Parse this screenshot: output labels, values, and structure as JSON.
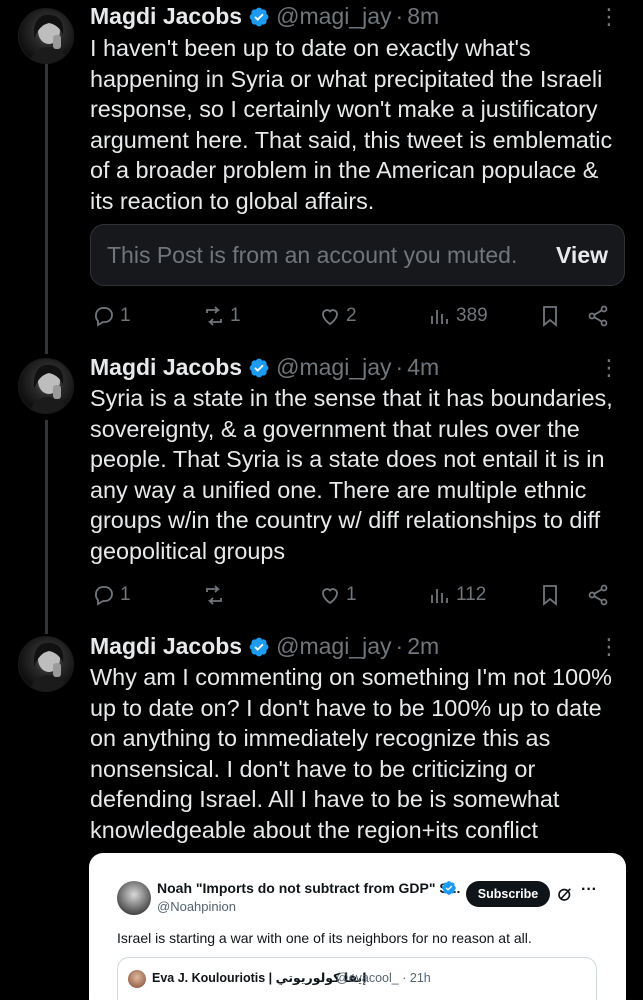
{
  "colors": {
    "background": "#000000",
    "text": "#e7e9ea",
    "muted": "#71767b",
    "verified": "#1d9bf0",
    "line": "#333639"
  },
  "tweets": [
    {
      "name": "Magdi Jacobs",
      "handle": "@magi_jay",
      "dot": "·",
      "time": "8m",
      "more": "⋮",
      "lines": [
        "I haven't been up to date on exactly what's",
        "happening in Syria or what precipitated the Israeli",
        "response, so I certainly won't make a justificatory",
        "argument here. That said, this tweet is emblematic",
        "of a broader problem in the American populace &",
        "its reaction to global affairs."
      ],
      "muted_notice": "This Post is from an account you muted.",
      "muted_view": "View",
      "replies": "1",
      "reposts": "1",
      "likes": "2",
      "views": "389"
    },
    {
      "name": "Magdi Jacobs",
      "handle": "@magi_jay",
      "dot": "·",
      "time": "4m",
      "more": "⋮",
      "lines": [
        "Syria is a state in the sense that it has boundaries,",
        "sovereignty, & a government that rules over the",
        "people. That Syria is a state does not entail it is in",
        "any way a unified one. There are multiple ethnic",
        "groups w/in the country w/ diff relationships to diff",
        "geopolitical groups"
      ],
      "replies": "1",
      "reposts": "",
      "likes": "1",
      "views": "112"
    },
    {
      "name": "Magdi Jacobs",
      "handle": "@magi_jay",
      "dot": "·",
      "time": "2m",
      "more": "⋮",
      "lines": [
        "Why am I commenting on something I'm not 100%",
        "up to date on? I don't have to be 100% up to date",
        "on anything to immediately recognize this as",
        "nonsensical. I don't have to be criticizing or",
        "defending Israel. All I have to be is somewhat",
        "knowledgeable about the region+its conflict"
      ]
    }
  ],
  "quote": {
    "name": "Noah \"Imports do not subtract from GDP\" S...",
    "handle": "@Noahpinion",
    "subscribe": "Subscribe",
    "more": "···",
    "text": "Israel is starting a war with one of its neighbors for no reason at all.",
    "inner": {
      "name": "Eva J. Koulouriotis | إيفا كولوريوتي",
      "handle": "@evacool_",
      "dot": "·",
      "time": "21h"
    }
  },
  "icons": [
    "reply-icon",
    "repost-icon",
    "like-icon",
    "views-icon",
    "bookmark-icon",
    "share-icon",
    "verified-badge-icon",
    "more-icon",
    "grok-icon"
  ]
}
